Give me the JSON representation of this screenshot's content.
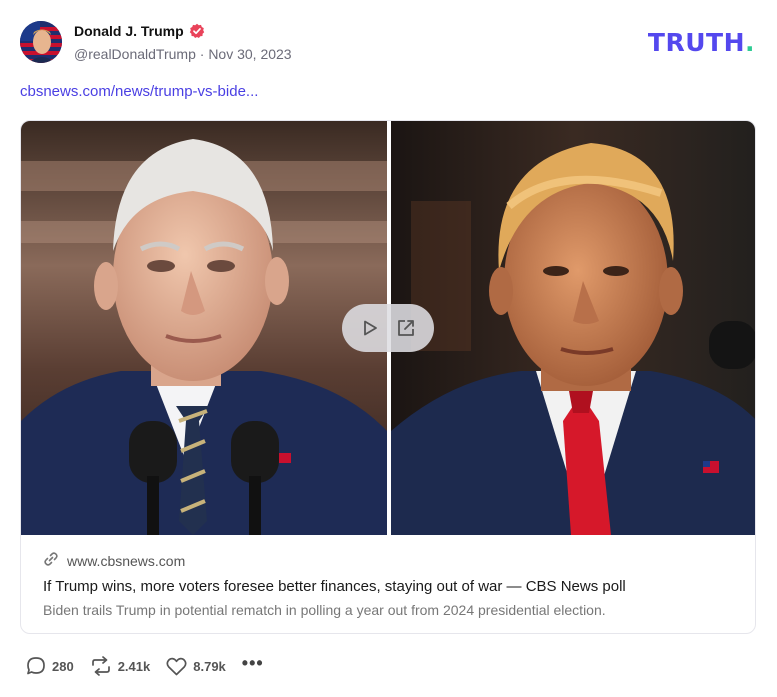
{
  "post": {
    "author_name": "Donald J. Trump",
    "handle": "@realDonaldTrump",
    "separator": "·",
    "date": "Nov 30, 2023",
    "link_text": "cbsnews.com/news/trump-vs-bide..."
  },
  "brand": {
    "name": "TRUTH",
    "dot": "."
  },
  "card": {
    "domain": "www.cbsnews.com",
    "headline": "If Trump wins, more voters foresee better finances, staying out of war — CBS News poll",
    "description": "Biden trails Trump in potential rematch in polling a year out from 2024 presidential election."
  },
  "actions": {
    "replies": "280",
    "retruths": "2.41k",
    "likes": "8.79k"
  },
  "colors": {
    "brand": "#5448ee",
    "brand_dot": "#2ecc94",
    "link": "#4a3fe3",
    "verified": "#e9435a"
  },
  "icons": [
    "verified-badge-icon",
    "play-icon",
    "open-external-icon",
    "link-icon",
    "reply-icon",
    "retruth-icon",
    "like-icon",
    "more-icon"
  ]
}
